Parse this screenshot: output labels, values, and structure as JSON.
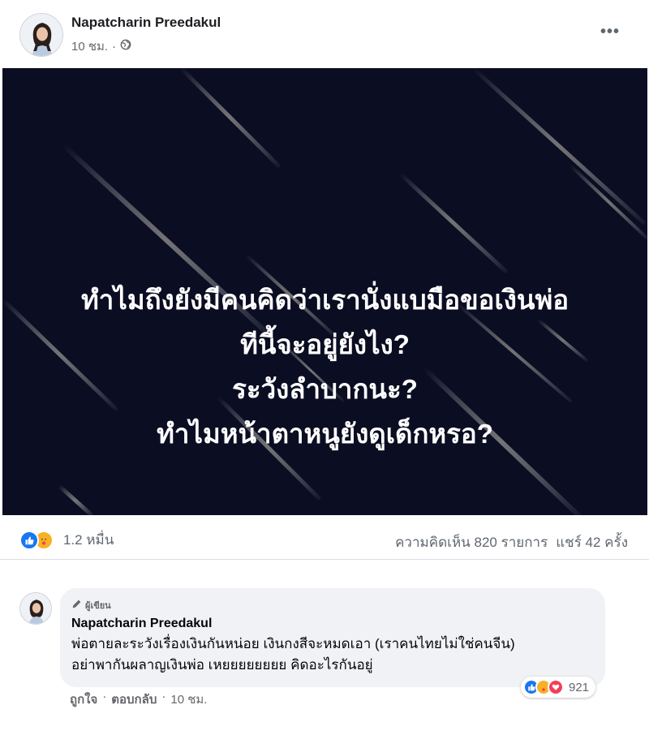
{
  "post": {
    "author": "Napatcharin Preedakul",
    "time": "10 ชม.",
    "separator": "·",
    "privacy_icon": "globe-icon",
    "more_icon": "more-horizontal-icon",
    "more_label": "•••",
    "image": {
      "background_color": "#0b0d22",
      "text_lines": [
        "ทำไมถึงยังมีคนคิดว่าเรานั่งแบมือขอเงินพ่อ",
        "ทีนี้จะอยู่ยังไง?",
        "ระวังลำบากนะ?",
        "ทำไมหน้าตาหนูยังดูเด็กหรอ?"
      ]
    },
    "stats": {
      "reaction_icons": [
        "like-icon",
        "care-icon"
      ],
      "reaction_count": "1.2 หมื่น",
      "comments": "ความคิดเห็น 820 รายการ",
      "shares": "แชร์ 42 ครั้ง"
    }
  },
  "comment": {
    "badge_icon": "pencil-icon",
    "badge_label": "ผู้เขียน",
    "author": "Napatcharin Preedakul",
    "text_lines": [
      "พ่อตายละระวังเรื่องเงินกันหน่อย เงินกงสีจะหมดเอา (เราคนไทยไม่ใช่คนจีน)",
      "อย่าพากันผลาญเงินพ่อ เหยยยยยยยย คิดอะไรกันอยู่"
    ],
    "reaction_icons": [
      "like-icon",
      "care-icon",
      "love-icon"
    ],
    "reaction_count": "921",
    "actions": {
      "like": "ถูกใจ",
      "sep1": "·",
      "reply": "ตอบกลับ",
      "sep2": "·",
      "time": "10 ชม."
    }
  },
  "colors": {
    "accent": "#1877f2",
    "care": "#f7b125",
    "love": "#f33e58",
    "secondary_text": "#65676b"
  }
}
